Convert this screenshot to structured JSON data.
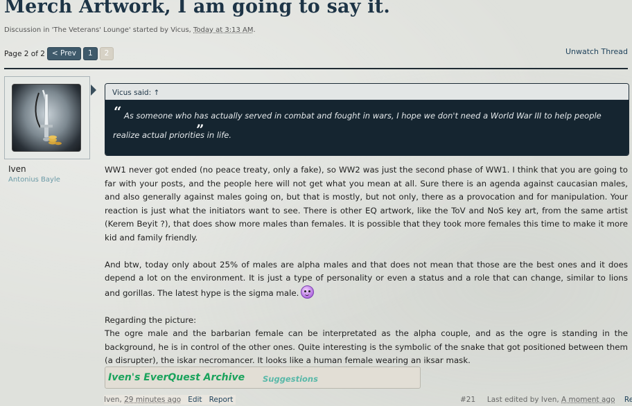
{
  "thread": {
    "title": "Merch Artwork, I am going to say it.",
    "meta_prefix": "Discussion in 'The Veterans' Lounge' started by ",
    "starter": "Vicus",
    "sep": ", ",
    "started_time": "Today at 3:13 AM",
    "end": "."
  },
  "pagination": {
    "label": "Page 2 of 2",
    "prev_label": "< Prev",
    "pages": [
      "1",
      "2"
    ],
    "current_page": "2"
  },
  "actions": {
    "unwatch": "Unwatch Thread"
  },
  "colors": {
    "title": "#1d3446",
    "accent": "#3f5a6b",
    "quote_bg": "#152530",
    "signature": "#1aa35c",
    "link": "#20435c"
  },
  "post": {
    "author": "Iven",
    "author_title": "Antonius Bayle",
    "avatar_icon": "dagger-avatar-image",
    "quote": {
      "header": "Vicus said: ↑",
      "open_mark": "“",
      "text": "As someone who has actually served in combat and fought in wars, I hope we don't need a World War III to help people realize actual priorities in life.",
      "close_mark": "”"
    },
    "paragraphs": [
      "WW1 never got ended (no peace treaty, only a fake), so WW2 was just the second phase of WW1. I think that you are going to far with your posts, and the people here will not get what you mean at all. Sure there is an agenda against caucasian males, and also generally against males going on, but that is mostly, but not only, there as a provocation and for manipulation. Your reaction is just what the initiators want to see. There is other EQ artwork, like the ToV and NoS key art, from the same artist (Kerem Beyit ?), that does show more males than females. It is possible that they took more females this time to make it more kid and family friendly.",
      "And btw, today only about 25% of males are alpha males and that does not mean that those are the best ones and it does depend a lot on the environment. It is just a type of personality or even a status and a role that can change, similar to lions and gorillas. The latest hype is the sigma male."
    ],
    "smiley_icon": "purple-smiley-icon",
    "picture_heading": "Regarding the picture:",
    "picture_text": "The ogre male and the barbarian female can be interpretated as the alpha couple, and as the ogre is standing in the background, he is in control of the other ones. Quite interesting is the symbolic of the snake that got positioned between them (a disrupter), the iskar necromancer. It looks like a human female wearing an iksar mask.",
    "signature": {
      "link": "Iven's EverQuest Archive",
      "suggestions": "Suggestions"
    },
    "footer": {
      "author": "Iven",
      "sep": ", ",
      "time": "29 minutes ago",
      "edit": "Edit",
      "report": "Report",
      "post_number": "#21",
      "last_edited_prefix": "Last edited by Iven, ",
      "last_edited_time": "A moment ago",
      "reply": "Reply"
    }
  }
}
